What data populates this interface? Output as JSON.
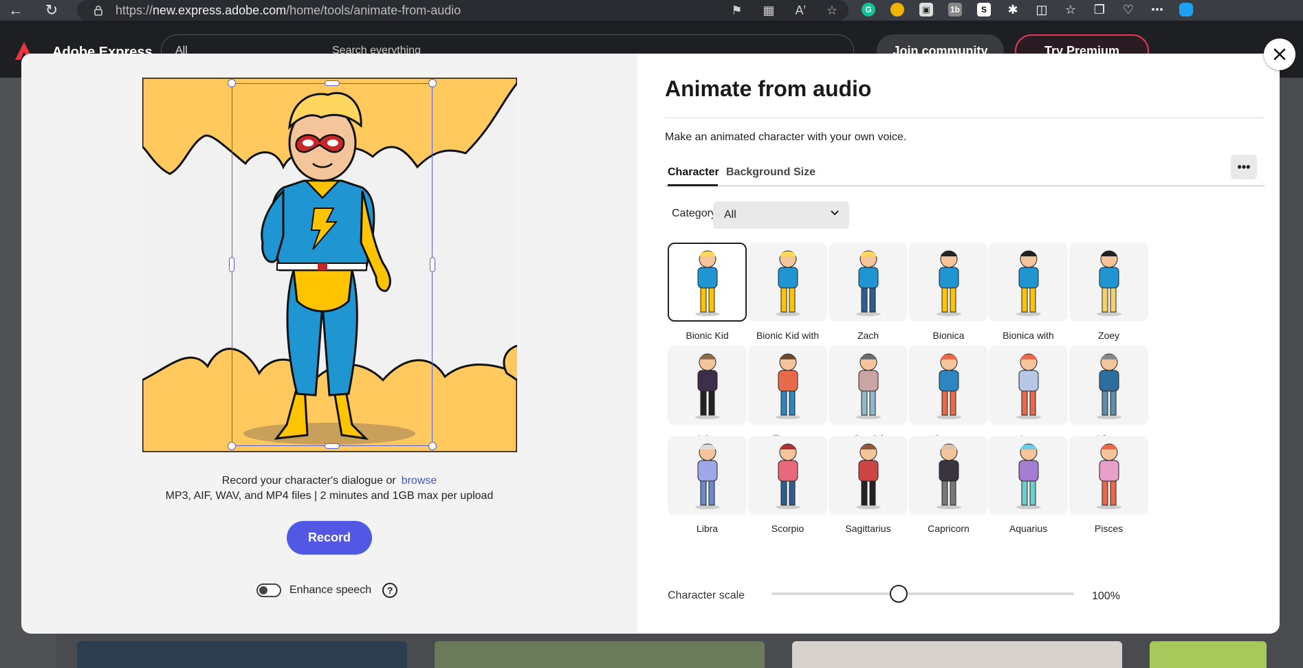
{
  "browser": {
    "url_prefix": "https://",
    "url_host": "new.express.adobe.com",
    "url_path": "/home/tools/animate-from-audio"
  },
  "app": {
    "name": "Adobe Express",
    "search_scope": "All",
    "search_placeholder": "Search everything",
    "join_label": "Join community",
    "premium_label": "Try Premium"
  },
  "modal": {
    "title": "Animate from audio",
    "subtitle": "Make an animated character with your own voice.",
    "tabs": [
      "Character",
      "Background",
      "Size"
    ],
    "active_tab": "Character",
    "more_label": "•••",
    "category_label": "Category",
    "category_value": "All",
    "record_text": "Record your character's dialogue or",
    "browse_label": "browse",
    "file_hint": "MP3, AIF, WAV, and MP4 files | 2 minutes and 1GB max per upload",
    "record_label": "Record",
    "enhance_label": "Enhance speech",
    "help_label": "?",
    "scale_label": "Character scale",
    "scale_value": "100%",
    "scale_fraction": 0.42
  },
  "characters": [
    {
      "label": "Bionic Kid",
      "selected": true
    },
    {
      "label": "Bionic Kid with Prosthetic"
    },
    {
      "label": "Zach"
    },
    {
      "label": "Bionica"
    },
    {
      "label": "Bionica with Prosthetic"
    },
    {
      "label": "Zoey"
    },
    {
      "label": "Aries"
    },
    {
      "label": "Taurus"
    },
    {
      "label": "Gemini"
    },
    {
      "label": "Cancer"
    },
    {
      "label": "Leo"
    },
    {
      "label": "Virgo"
    },
    {
      "label": "Libra"
    },
    {
      "label": "Scorpio"
    },
    {
      "label": "Sagittarius"
    },
    {
      "label": "Capricorn"
    },
    {
      "label": "Aquarius"
    },
    {
      "label": "Pisces"
    }
  ],
  "colors": {
    "accent": "#5258e4",
    "link": "#3d55d6",
    "preview_bg": "#ffc95e",
    "hero_blue": "#1f95d2",
    "hero_yellow": "#ffc400"
  }
}
